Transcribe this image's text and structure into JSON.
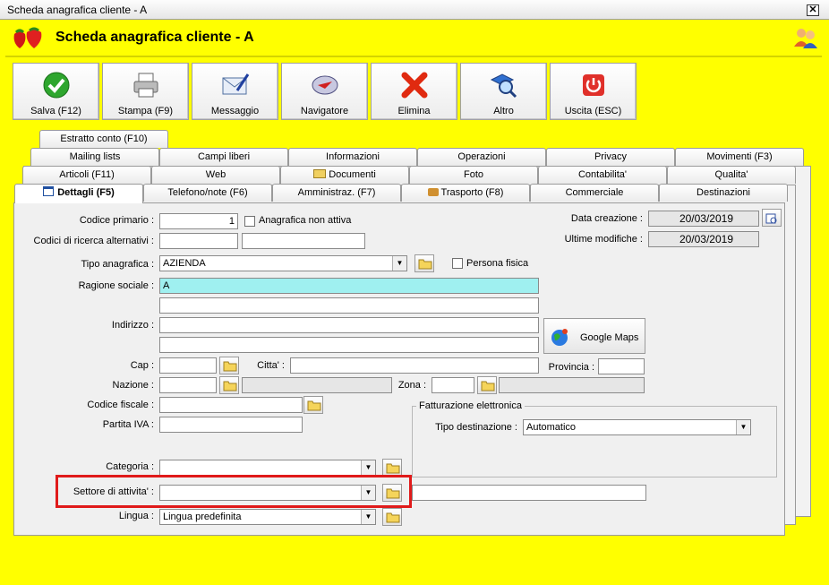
{
  "window": {
    "title": "Scheda anagrafica cliente - A",
    "close": "✕"
  },
  "header": {
    "title": "Scheda anagrafica cliente - A"
  },
  "toolbar": [
    {
      "label": "Salva (F12)",
      "icon": "check-icon"
    },
    {
      "label": "Stampa (F9)",
      "icon": "printer-icon"
    },
    {
      "label": "Messaggio",
      "icon": "mail-pen-icon"
    },
    {
      "label": "Navigatore",
      "icon": "compass-icon"
    },
    {
      "label": "Elimina",
      "icon": "delete-x-icon"
    },
    {
      "label": "Altro",
      "icon": "book-magnifier-icon"
    },
    {
      "label": "Uscita (ESC)",
      "icon": "power-icon"
    }
  ],
  "tabs": {
    "row4": [
      "Estratto conto (F10)"
    ],
    "row3": [
      "Mailing lists",
      "Campi liberi",
      "Informazioni",
      "Operazioni",
      "Privacy",
      "Movimenti (F3)"
    ],
    "row2": [
      "Articoli (F11)",
      "Web",
      "Documenti",
      "Foto",
      "Contabilita'",
      "Qualita'"
    ],
    "row1": [
      "Dettagli (F5)",
      "Telefono/note (F6)",
      "Amministraz. (F7)",
      "Trasporto (F8)",
      "Commerciale",
      "Destinazioni"
    ]
  },
  "form": {
    "codice_primario_label": "Codice primario :",
    "codice_primario_value": "1",
    "anagrafica_non_attiva": "Anagrafica non attiva",
    "codici_ricerca_label": "Codici di ricerca alternativi :",
    "data_creazione_label": "Data creazione :",
    "data_creazione_value": "20/03/2019",
    "ultime_modifiche_label": "Ultime modifiche :",
    "ultime_modifiche_value": "20/03/2019",
    "tipo_anagrafica_label": "Tipo anagrafica :",
    "tipo_anagrafica_value": "AZIENDA",
    "persona_fisica": "Persona fisica",
    "ragione_sociale_label": "Ragione sociale :",
    "ragione_sociale_value": "A",
    "indirizzo_label": "Indirizzo :",
    "google_maps": "Google Maps",
    "cap_label": "Cap :",
    "citta_label": "Citta' :",
    "provincia_label": "Provincia :",
    "nazione_label": "Nazione :",
    "zona_label": "Zona :",
    "codice_fiscale_label": "Codice fiscale :",
    "partita_iva_label": "Partita IVA :",
    "fatturazione_title": "Fatturazione elettronica",
    "tipo_destinazione_label": "Tipo destinazione :",
    "tipo_destinazione_value": "Automatico",
    "categoria_label": "Categoria :",
    "settore_label": "Settore di attivita' :",
    "lingua_label": "Lingua :",
    "lingua_value": "Lingua predefinita"
  },
  "colors": {
    "background": "#ffff00",
    "highlight": "#e01a1a",
    "ragione_bg": "#9ff0f0"
  }
}
